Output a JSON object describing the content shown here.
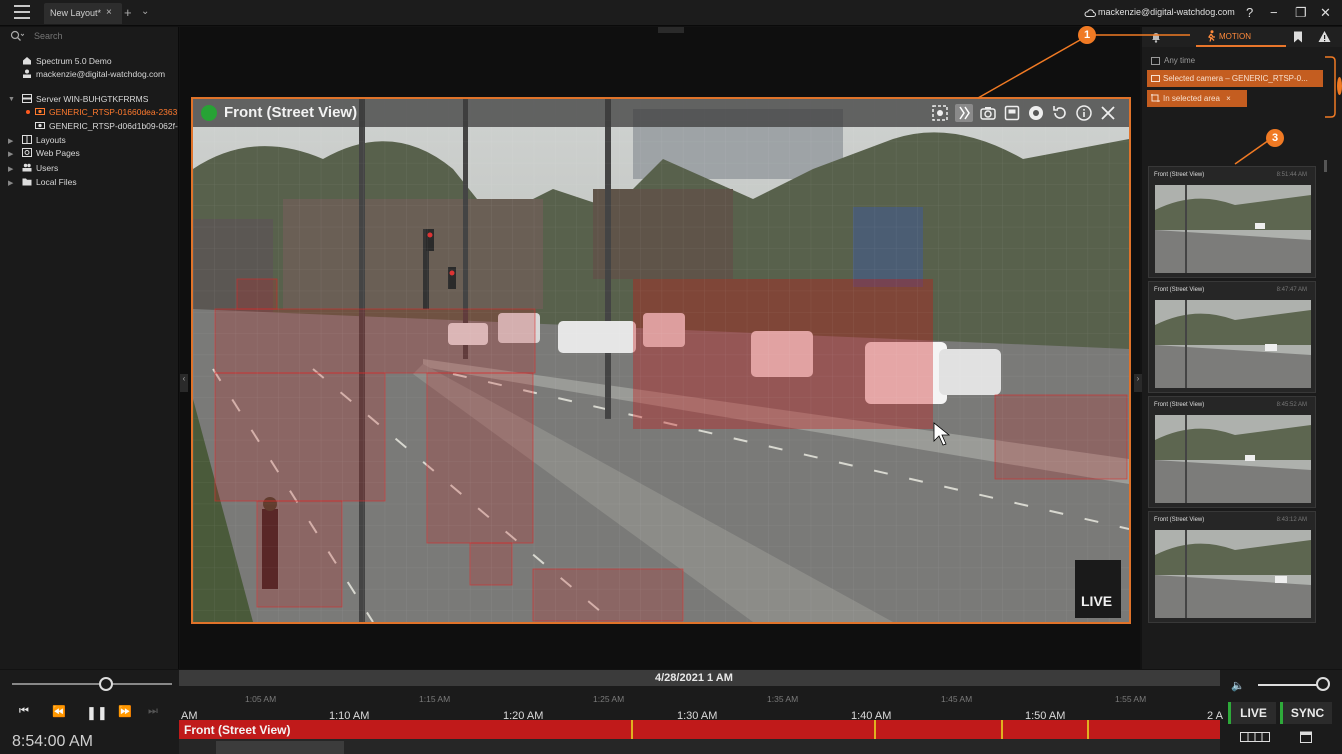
{
  "titlebar": {
    "tab_label": "New Layout*",
    "tab_close": "×",
    "tab_add": "+",
    "tab_menu": "⌄",
    "account": "mackenzie@digital-watchdog.com",
    "help": "?",
    "minimize": "−",
    "maximize": "❐",
    "close": "✕"
  },
  "left_panel": {
    "search_placeholder": "Search",
    "system_name": "Spectrum 5.0 Demo",
    "user_email": "mackenzie@digital-watchdog.com",
    "server": "Server WIN-BUHGTKFRRMS",
    "camera_selected": "GENERIC_RTSP-01660dea-2363",
    "camera_other": "GENERIC_RTSP-d06d1b09-062f-",
    "items": [
      "Layouts",
      "Web Pages",
      "Users",
      "Local Files"
    ]
  },
  "camera": {
    "title": "Front (Street View)",
    "live": "LIVE",
    "tools": [
      "zoom-window-icon",
      "motion-search-icon",
      "screenshot-icon",
      "save-icon",
      "fisheye-icon",
      "rotate-icon",
      "info-icon",
      "close-icon"
    ]
  },
  "right_panel": {
    "motion_tab": "MOTION",
    "any_time": "Any time",
    "filter_camera": "Selected camera – GENERIC_RTSP-0...",
    "filter_area": "In selected area",
    "filter_area_close": "×",
    "results": [
      {
        "title": "Front (Street View)",
        "time": "8:51:44 AM"
      },
      {
        "title": "Front (Street View)",
        "time": "8:47:47 AM"
      },
      {
        "title": "Front (Street View)",
        "time": "8:45:52 AM"
      },
      {
        "title": "Front (Street View)",
        "time": "8:43:12 AM"
      }
    ]
  },
  "callouts": [
    "1",
    "2",
    "3"
  ],
  "timeline": {
    "current_time": "8:54:00 AM",
    "date": "4/28/2021 1 AM",
    "major_ticks": [
      "AM",
      "1:10 AM",
      "1:20 AM",
      "1:30 AM",
      "1:40 AM",
      "1:50 AM",
      "2 A"
    ],
    "minor_ticks": [
      "1:05 AM",
      "1:15 AM",
      "1:25 AM",
      "1:35 AM",
      "1:45 AM",
      "1:55 AM"
    ],
    "track_label": "Front (Street View)",
    "live_button": "LIVE",
    "sync_button": "SYNC"
  },
  "colors": {
    "accent": "#e9762b",
    "motion_red": "#c01a1a",
    "rec_green": "#27a335"
  }
}
